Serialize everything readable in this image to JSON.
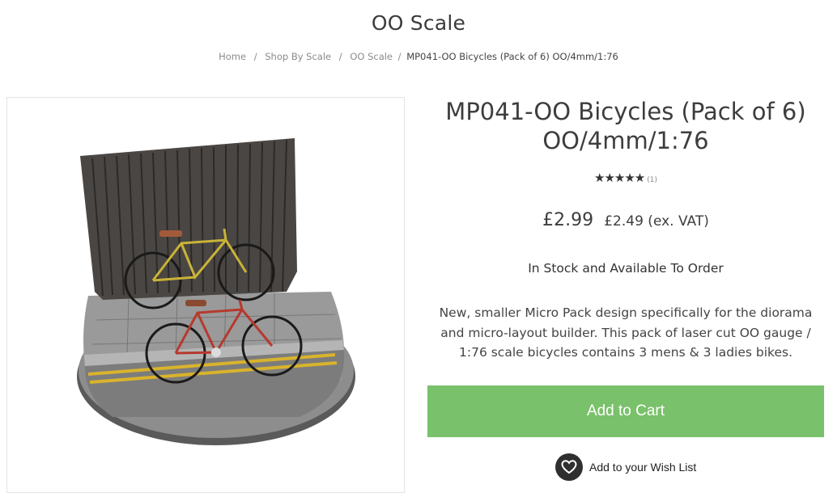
{
  "category": {
    "title": "OO Scale"
  },
  "breadcrumb": {
    "items": [
      "Home",
      "Shop By Scale",
      "OO Scale"
    ],
    "current": "MP041-OO Bicycles (Pack of 6) OO/4mm/1:76"
  },
  "product": {
    "title_line1": "MP041-OO Bicycles (Pack of 6)",
    "title_line2": "OO/4mm/1:76",
    "rating_stars": "★★★★★",
    "rating_value": 5,
    "rating_count": "(1)",
    "price": "£2.99",
    "price_ex_vat": "£2.49 (ex. VAT)",
    "stock_status": "In Stock and Available To Order",
    "description": "New, smaller Micro Pack design specifically for the diorama and micro-layout builder. This pack of laser cut OO gauge / 1:76 scale bicycles contains 3 mens & 3 ladies bikes.",
    "image_icon": "product-photo-bicycles-diorama"
  },
  "actions": {
    "add_to_cart": "Add to Cart",
    "wishlist": "Add to your Wish List",
    "wishlist_icon": "heart-icon"
  },
  "colors": {
    "cart_button": "#79c16a",
    "text_dark": "#3d3d3d",
    "wishlist_circle": "#2f2f2f"
  }
}
